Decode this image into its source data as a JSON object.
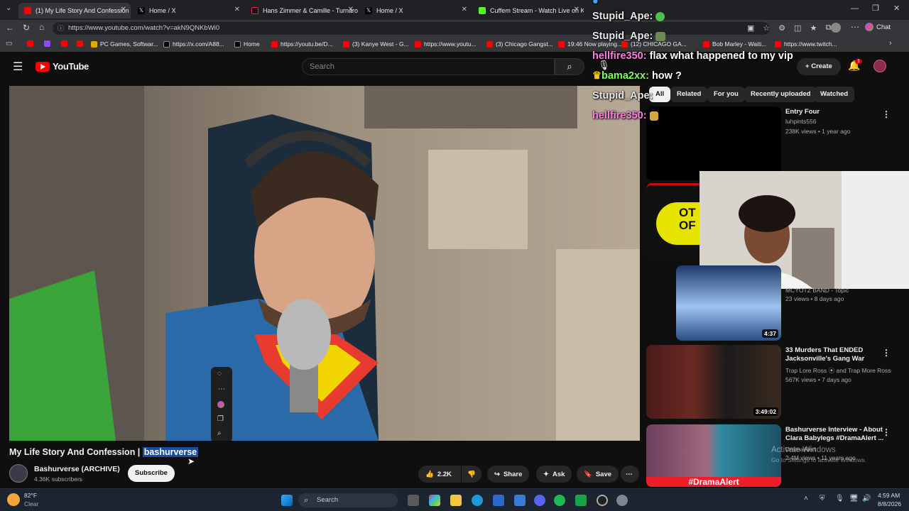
{
  "browser": {
    "tabs": [
      {
        "title": "(1) My Life Story And Confession |",
        "color": "#ff0000",
        "active": true
      },
      {
        "title": "Home / X",
        "color": "#ffffff",
        "active": false
      },
      {
        "title": "Hans Zimmer & Camille - Turnaro",
        "color": "#ee1d52",
        "active": false
      },
      {
        "title": "Home / X",
        "color": "#ffffff",
        "active": false
      },
      {
        "title": "Cuffem Stream - Watch Live on Ki",
        "color": "#53fc18",
        "active": false
      }
    ],
    "url": "https://www.youtube.com/watch?v=akN9QNKbWi0",
    "bookmarks": [
      "PC Games, Softwar...",
      "https://x.com/A88...",
      "Home",
      "https://youtu.be/D...",
      "(3) Kanye West - G...",
      "https://www.youtu...",
      "(3) Chicago Gangst...",
      "19:46 Now playing...",
      "(12) CHICAGO GA...",
      "Bob Marley - Waiti...",
      "https://www.twitch..."
    ],
    "chat_button": "Chat"
  },
  "youtube": {
    "logo_text": "YouTube",
    "search_placeholder": "Search",
    "create_label": "Create",
    "notif_count": "1",
    "chips": [
      "All",
      "Related",
      "For you",
      "Recently uploaded",
      "Watched"
    ],
    "video_title_main": "My Life Story And Confession | ",
    "video_title_highlight": "bashurverse",
    "channel_name": "Bashurverse (ARCHIVE)",
    "subscribers": "4.36K subscribers",
    "subscribe_label": "Subscribe",
    "likes": "2.2K",
    "share_label": "Share",
    "ask_label": "Ask",
    "save_label": "Save",
    "recs": [
      {
        "title": "Entry Four",
        "channel": "luhpints556",
        "meta": "238K views • 1 year ago",
        "duration": ""
      },
      {
        "title": "",
        "channel": "MCYOTZ BAND - Topic",
        "meta": "23 views • 8 days ago",
        "duration": "4:37"
      },
      {
        "title": "33 Murders That ENDED Jacksonville's Gang War",
        "channel": "Trap Lore Ross",
        "channel2": "and Trap More Ross",
        "meta": "567K views • 7 days ago",
        "duration": "3:49:02"
      },
      {
        "title": "Bashurverse Interview - About Clara Babylegs #DramaAlert ...",
        "channel": "DramaAlert",
        "meta": "2.4M views • 11 years ago",
        "duration": ""
      }
    ],
    "thumb_text_2": "OT OF",
    "thumb_text_4": "#DramaAlert",
    "watermark_line1": "Activate Windows",
    "watermark_line2": "Go to Settings to activate Windows."
  },
  "chat_overlay": [
    {
      "user": "Stupid_Ape:",
      "msg": "",
      "emoji": "green"
    },
    {
      "user": "Stupid_Ape:",
      "msg": "",
      "emoji": "cactus"
    },
    {
      "user": "hellfire350:",
      "msg": "flax what happened to my vip"
    },
    {
      "user": "bama2xx:",
      "msg": "how ?"
    },
    {
      "user": "Stupid_Ape:",
      "msg": ""
    },
    {
      "user": "hellfire350:",
      "msg": ""
    }
  ],
  "taskbar": {
    "weather_temp": "82°F",
    "weather_desc": "Clear",
    "search_label": "Search",
    "time": "4:59 AM",
    "date": "8/8/2026"
  }
}
